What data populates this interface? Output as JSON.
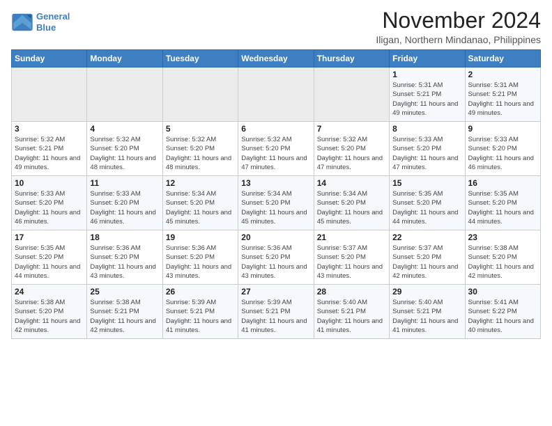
{
  "header": {
    "logo_line1": "General",
    "logo_line2": "Blue",
    "month": "November 2024",
    "location": "Iligan, Northern Mindanao, Philippines"
  },
  "days_of_week": [
    "Sunday",
    "Monday",
    "Tuesday",
    "Wednesday",
    "Thursday",
    "Friday",
    "Saturday"
  ],
  "weeks": [
    [
      {
        "day": "",
        "info": ""
      },
      {
        "day": "",
        "info": ""
      },
      {
        "day": "",
        "info": ""
      },
      {
        "day": "",
        "info": ""
      },
      {
        "day": "",
        "info": ""
      },
      {
        "day": "1",
        "info": "Sunrise: 5:31 AM\nSunset: 5:21 PM\nDaylight: 11 hours\nand 49 minutes."
      },
      {
        "day": "2",
        "info": "Sunrise: 5:31 AM\nSunset: 5:21 PM\nDaylight: 11 hours\nand 49 minutes."
      }
    ],
    [
      {
        "day": "3",
        "info": "Sunrise: 5:32 AM\nSunset: 5:21 PM\nDaylight: 11 hours\nand 49 minutes."
      },
      {
        "day": "4",
        "info": "Sunrise: 5:32 AM\nSunset: 5:20 PM\nDaylight: 11 hours\nand 48 minutes."
      },
      {
        "day": "5",
        "info": "Sunrise: 5:32 AM\nSunset: 5:20 PM\nDaylight: 11 hours\nand 48 minutes."
      },
      {
        "day": "6",
        "info": "Sunrise: 5:32 AM\nSunset: 5:20 PM\nDaylight: 11 hours\nand 47 minutes."
      },
      {
        "day": "7",
        "info": "Sunrise: 5:32 AM\nSunset: 5:20 PM\nDaylight: 11 hours\nand 47 minutes."
      },
      {
        "day": "8",
        "info": "Sunrise: 5:33 AM\nSunset: 5:20 PM\nDaylight: 11 hours\nand 47 minutes."
      },
      {
        "day": "9",
        "info": "Sunrise: 5:33 AM\nSunset: 5:20 PM\nDaylight: 11 hours\nand 46 minutes."
      }
    ],
    [
      {
        "day": "10",
        "info": "Sunrise: 5:33 AM\nSunset: 5:20 PM\nDaylight: 11 hours\nand 46 minutes."
      },
      {
        "day": "11",
        "info": "Sunrise: 5:33 AM\nSunset: 5:20 PM\nDaylight: 11 hours\nand 46 minutes."
      },
      {
        "day": "12",
        "info": "Sunrise: 5:34 AM\nSunset: 5:20 PM\nDaylight: 11 hours\nand 45 minutes."
      },
      {
        "day": "13",
        "info": "Sunrise: 5:34 AM\nSunset: 5:20 PM\nDaylight: 11 hours\nand 45 minutes."
      },
      {
        "day": "14",
        "info": "Sunrise: 5:34 AM\nSunset: 5:20 PM\nDaylight: 11 hours\nand 45 minutes."
      },
      {
        "day": "15",
        "info": "Sunrise: 5:35 AM\nSunset: 5:20 PM\nDaylight: 11 hours\nand 44 minutes."
      },
      {
        "day": "16",
        "info": "Sunrise: 5:35 AM\nSunset: 5:20 PM\nDaylight: 11 hours\nand 44 minutes."
      }
    ],
    [
      {
        "day": "17",
        "info": "Sunrise: 5:35 AM\nSunset: 5:20 PM\nDaylight: 11 hours\nand 44 minutes."
      },
      {
        "day": "18",
        "info": "Sunrise: 5:36 AM\nSunset: 5:20 PM\nDaylight: 11 hours\nand 43 minutes."
      },
      {
        "day": "19",
        "info": "Sunrise: 5:36 AM\nSunset: 5:20 PM\nDaylight: 11 hours\nand 43 minutes."
      },
      {
        "day": "20",
        "info": "Sunrise: 5:36 AM\nSunset: 5:20 PM\nDaylight: 11 hours\nand 43 minutes."
      },
      {
        "day": "21",
        "info": "Sunrise: 5:37 AM\nSunset: 5:20 PM\nDaylight: 11 hours\nand 43 minutes."
      },
      {
        "day": "22",
        "info": "Sunrise: 5:37 AM\nSunset: 5:20 PM\nDaylight: 11 hours\nand 42 minutes."
      },
      {
        "day": "23",
        "info": "Sunrise: 5:38 AM\nSunset: 5:20 PM\nDaylight: 11 hours\nand 42 minutes."
      }
    ],
    [
      {
        "day": "24",
        "info": "Sunrise: 5:38 AM\nSunset: 5:20 PM\nDaylight: 11 hours\nand 42 minutes."
      },
      {
        "day": "25",
        "info": "Sunrise: 5:38 AM\nSunset: 5:21 PM\nDaylight: 11 hours\nand 42 minutes."
      },
      {
        "day": "26",
        "info": "Sunrise: 5:39 AM\nSunset: 5:21 PM\nDaylight: 11 hours\nand 41 minutes."
      },
      {
        "day": "27",
        "info": "Sunrise: 5:39 AM\nSunset: 5:21 PM\nDaylight: 11 hours\nand 41 minutes."
      },
      {
        "day": "28",
        "info": "Sunrise: 5:40 AM\nSunset: 5:21 PM\nDaylight: 11 hours\nand 41 minutes."
      },
      {
        "day": "29",
        "info": "Sunrise: 5:40 AM\nSunset: 5:21 PM\nDaylight: 11 hours\nand 41 minutes."
      },
      {
        "day": "30",
        "info": "Sunrise: 5:41 AM\nSunset: 5:22 PM\nDaylight: 11 hours\nand 40 minutes."
      }
    ]
  ]
}
